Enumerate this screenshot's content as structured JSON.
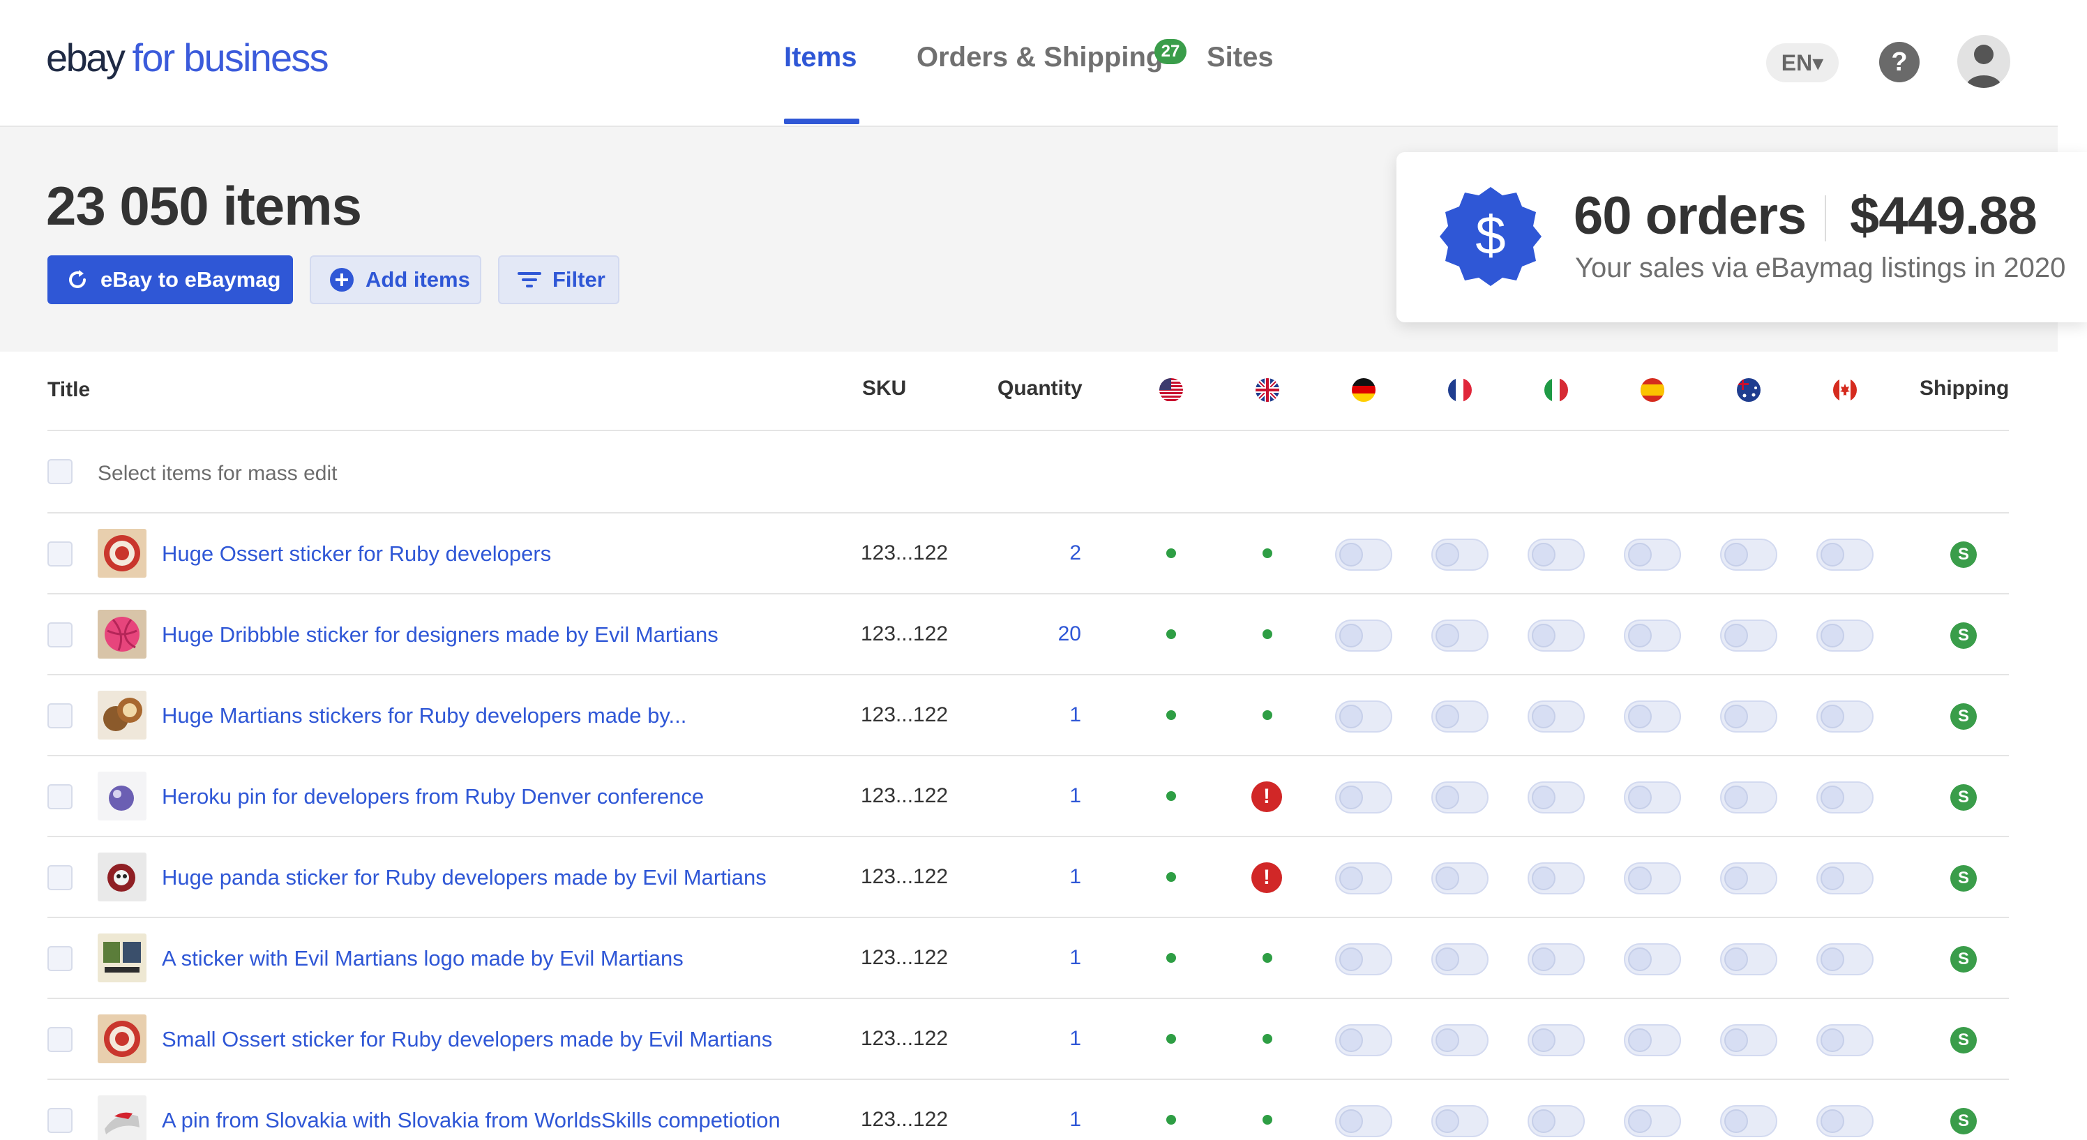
{
  "header": {
    "logo_left": "ebay",
    "logo_right": "for business",
    "nav": [
      {
        "label": "Items",
        "active": true
      },
      {
        "label": "Orders & Shipping",
        "badge": "27"
      },
      {
        "label": "Sites"
      }
    ],
    "language": "EN▾",
    "help": "?"
  },
  "summary": {
    "items_count": "23 050 items",
    "buttons": {
      "sync": "eBay to eBaymag",
      "add": "Add items",
      "filter": "Filter"
    },
    "sales": {
      "orders": "60 orders",
      "amount": "$449.88",
      "caption": "Your sales via eBaymag listings in 2020",
      "badge_symbol": "$"
    }
  },
  "table": {
    "columns": {
      "title": "Title",
      "sku": "SKU",
      "quantity": "Quantity",
      "shipping": "Shipping"
    },
    "flags": [
      "us-flag-icon",
      "uk-flag-icon",
      "de-flag-icon",
      "fr-flag-icon",
      "it-flag-icon",
      "es-flag-icon",
      "au-flag-icon",
      "ca-flag-icon"
    ],
    "mass_edit_label": "Select items for mass edit",
    "rows": [
      {
        "title": "Huge Ossert sticker for Ruby developers",
        "sku": "123...122",
        "qty": "2",
        "us": "ok",
        "uk": "ok",
        "thumb": "ossert"
      },
      {
        "title": "Huge Dribbble sticker for designers made by Evil Martians",
        "sku": "123...122",
        "qty": "20",
        "us": "ok",
        "uk": "ok",
        "thumb": "dribbble"
      },
      {
        "title": "Huge Martians stickers for Ruby developers made by...",
        "sku": "123...122",
        "qty": "1",
        "us": "ok",
        "uk": "ok",
        "thumb": "martians"
      },
      {
        "title": "Heroku pin for developers from Ruby Denver conference",
        "sku": "123...122",
        "qty": "1",
        "us": "ok",
        "uk": "error",
        "thumb": "heroku"
      },
      {
        "title": "Huge panda sticker for Ruby developers made by Evil Martians",
        "sku": "123...122",
        "qty": "1",
        "us": "ok",
        "uk": "error",
        "thumb": "panda"
      },
      {
        "title": "A sticker with Evil Martians logo made by Evil Martians",
        "sku": "123...122",
        "qty": "1",
        "us": "ok",
        "uk": "ok",
        "thumb": "logo"
      },
      {
        "title": "Small Ossert sticker for Ruby developers made by Evil Martians",
        "sku": "123...122",
        "qty": "1",
        "us": "ok",
        "uk": "ok",
        "thumb": "ossert"
      },
      {
        "title": "A pin from Slovakia with Slovakia from WorldsSkills competiotion",
        "sku": "123...122",
        "qty": "1",
        "us": "ok",
        "uk": "ok",
        "thumb": "slovakia"
      }
    ],
    "shipping_symbol": "S",
    "error_symbol": "!"
  },
  "colors": {
    "accent": "#2f57d6",
    "success": "#2e9e44",
    "error": "#d12727"
  }
}
